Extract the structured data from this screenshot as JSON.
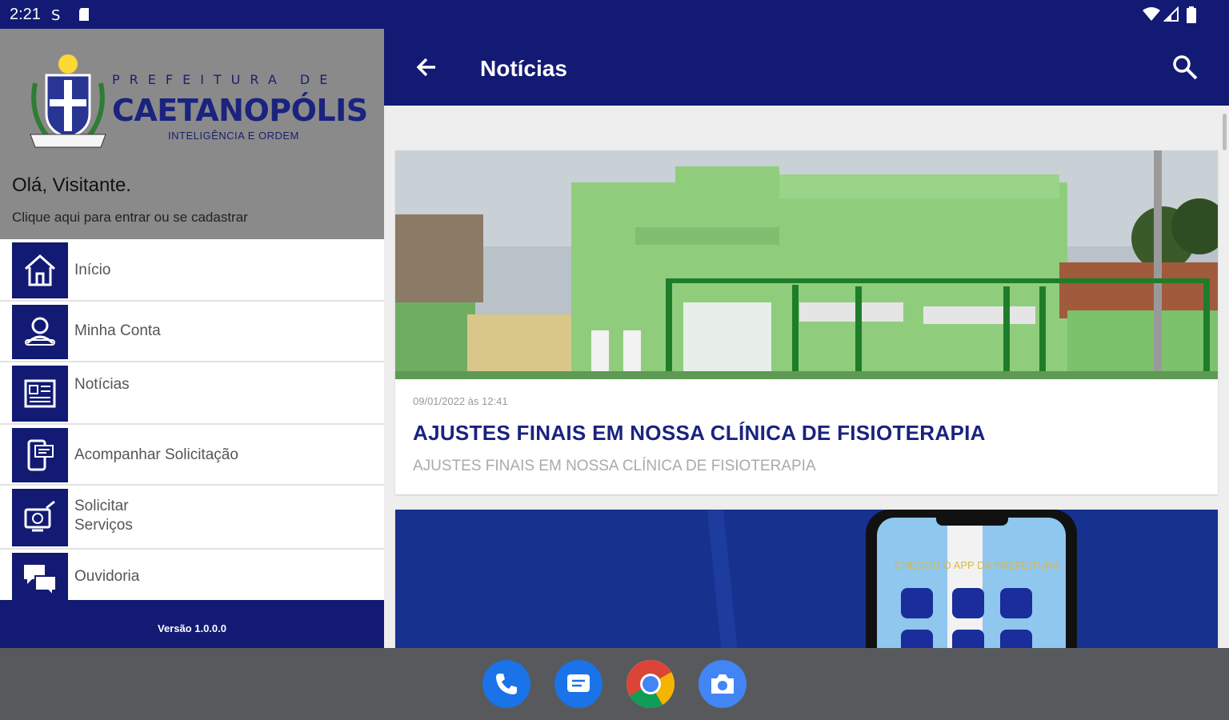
{
  "status_bar": {
    "time": "2:21"
  },
  "drawer": {
    "logo": {
      "top_text": "PREFEITURA DE",
      "main_text": "CAETANOPÓLIS",
      "sub_text": "INTELIGÊNCIA E ORDEM"
    },
    "greeting": "Olá, Visitante.",
    "login_hint": "Clique aqui para entrar ou se cadastrar",
    "menu": [
      {
        "label": "Início",
        "icon": "home-icon"
      },
      {
        "label": "Minha Conta",
        "icon": "account-icon"
      },
      {
        "label": "Notícias",
        "icon": "newspaper-icon"
      },
      {
        "label": "Acompanhar Solicitação",
        "icon": "phone-tracking-icon"
      },
      {
        "label": "Solicitar Serviços",
        "icon": "request-service-icon"
      },
      {
        "label": "Ouvidoria",
        "icon": "chat-icon"
      }
    ],
    "version": "Versão 1.0.0.0"
  },
  "app_bar": {
    "title": "Notícias"
  },
  "news": [
    {
      "date": "09/01/2022 às 12:41",
      "title": "AJUSTES FINAIS EM NOSSA CLÍNICA DE FISIOTERAPIA",
      "subtitle": "AJUSTES FINAIS EM NOSSA CLÍNICA DE FISIOTERAPIA"
    },
    {
      "image_text": "CHEGOU O APP DA PREFEITURA"
    }
  ],
  "dock": [
    "phone-app",
    "messages-app",
    "chrome-app",
    "camera-app"
  ],
  "colors": {
    "primary": "#121a73",
    "title": "#1a237e",
    "header_gray": "#8a8a8a"
  }
}
